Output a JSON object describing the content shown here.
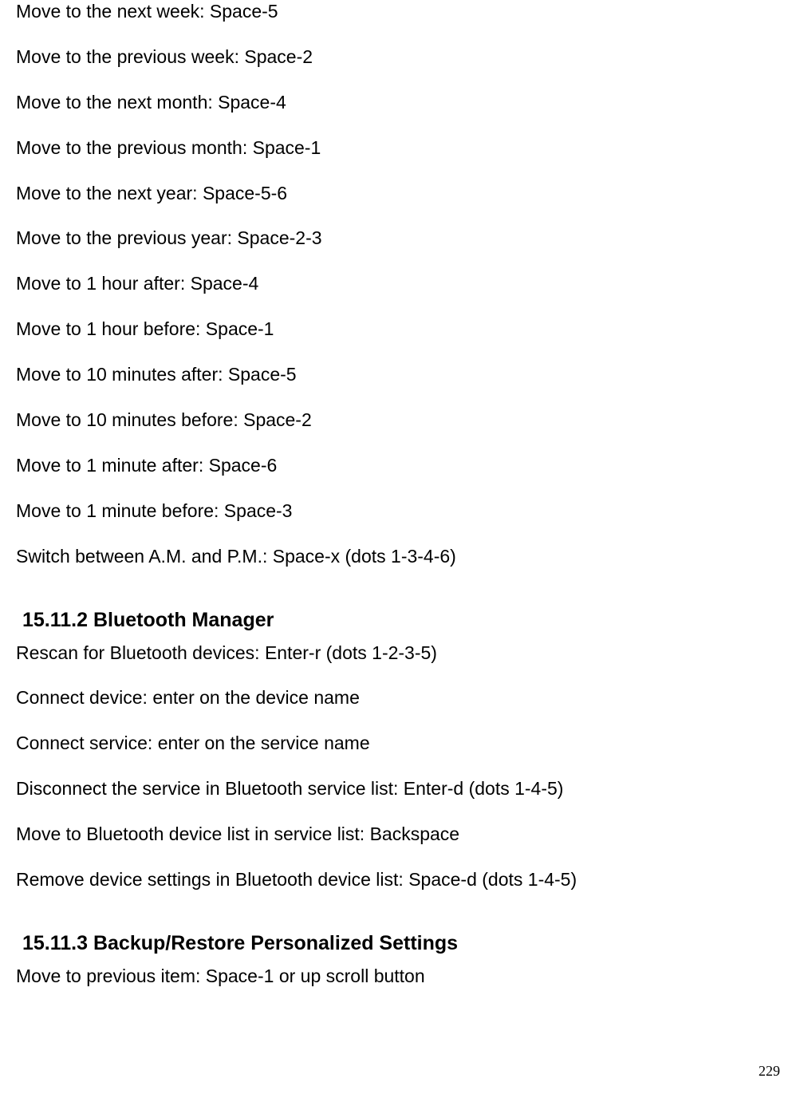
{
  "section1": {
    "lines": [
      "Move to the next week: Space-5",
      "Move to the previous week: Space-2",
      "Move to the next month: Space-4",
      "Move to the previous month: Space-1",
      "Move to the next year: Space-5-6",
      "Move to the previous year: Space-2-3",
      "Move to 1 hour after: Space-4",
      "Move to 1 hour before: Space-1",
      "Move to 10 minutes after: Space-5",
      "Move to 10 minutes before: Space-2",
      "Move to 1 minute after: Space-6",
      "Move to 1 minute before: Space-3",
      "Switch between A.M. and P.M.: Space-x (dots 1-3-4-6)"
    ]
  },
  "section2": {
    "heading": "15.11.2 Bluetooth Manager",
    "lines": [
      "Rescan for Bluetooth devices: Enter-r (dots 1-2-3-5)",
      "Connect device: enter on the device name",
      "Connect service: enter on the service name",
      "Disconnect the service in Bluetooth service list: Enter-d (dots 1-4-5)",
      "Move to Bluetooth device list in service list: Backspace",
      "Remove device settings in Bluetooth device list: Space-d (dots 1-4-5)"
    ]
  },
  "section3": {
    "heading": "15.11.3 Backup/Restore Personalized Settings",
    "lines": [
      "Move to previous item: Space-1 or up scroll button"
    ]
  },
  "pageNumber": "229"
}
